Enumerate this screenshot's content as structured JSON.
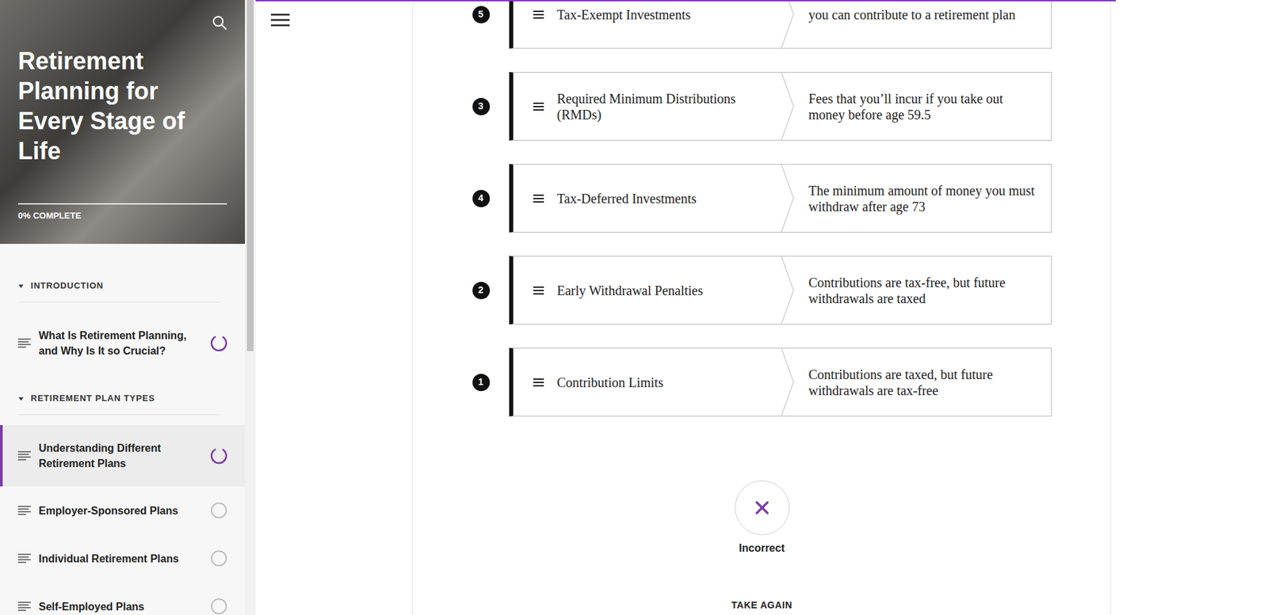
{
  "top_progress": {
    "level": 0.85
  },
  "course": {
    "title": "Retirement Planning for Every Stage of Life",
    "progress": {
      "label": "0% COMPLETE",
      "level": 0
    }
  },
  "sidebar": {
    "sections": [
      {
        "title": "INTRODUCTION",
        "expanded": true,
        "items": [
          {
            "label": "What Is Retirement Planning, and Why Is It so Crucial?",
            "selected": false,
            "started": true
          }
        ]
      },
      {
        "title": "RETIREMENT PLAN TYPES",
        "expanded": true,
        "items": [
          {
            "label": "Understanding Different Retirement Plans",
            "selected": true,
            "started": true
          },
          {
            "label": "Employer-Sponsored Plans",
            "selected": false,
            "started": false
          },
          {
            "label": "Individual Retirement Plans",
            "selected": false,
            "started": false
          },
          {
            "label": "Self-Employed Plans",
            "selected": false,
            "started": false
          }
        ]
      }
    ]
  },
  "quiz": {
    "rows": [
      {
        "number": "5",
        "term": "Tax-Exempt Investments",
        "definition": "you can contribute to a retirement plan"
      },
      {
        "number": "3",
        "term": "Required Minimum Distributions (RMDs)",
        "definition": "Fees that you’ll incur if you take out money before age 59.5"
      },
      {
        "number": "4",
        "term": "Tax-Deferred Investments",
        "definition": "The minimum amount of money you must withdraw after age 73"
      },
      {
        "number": "2",
        "term": "Early Withdrawal Penalties",
        "definition": "Contributions are tax-free, but future withdrawals are taxed"
      },
      {
        "number": "1",
        "term": "Contribution Limits",
        "definition": "Contributions are taxed, but future withdrawals are tax-free"
      }
    ],
    "result": {
      "correct": false,
      "label": "Incorrect"
    },
    "retry_label": "TAKE AGAIN"
  }
}
